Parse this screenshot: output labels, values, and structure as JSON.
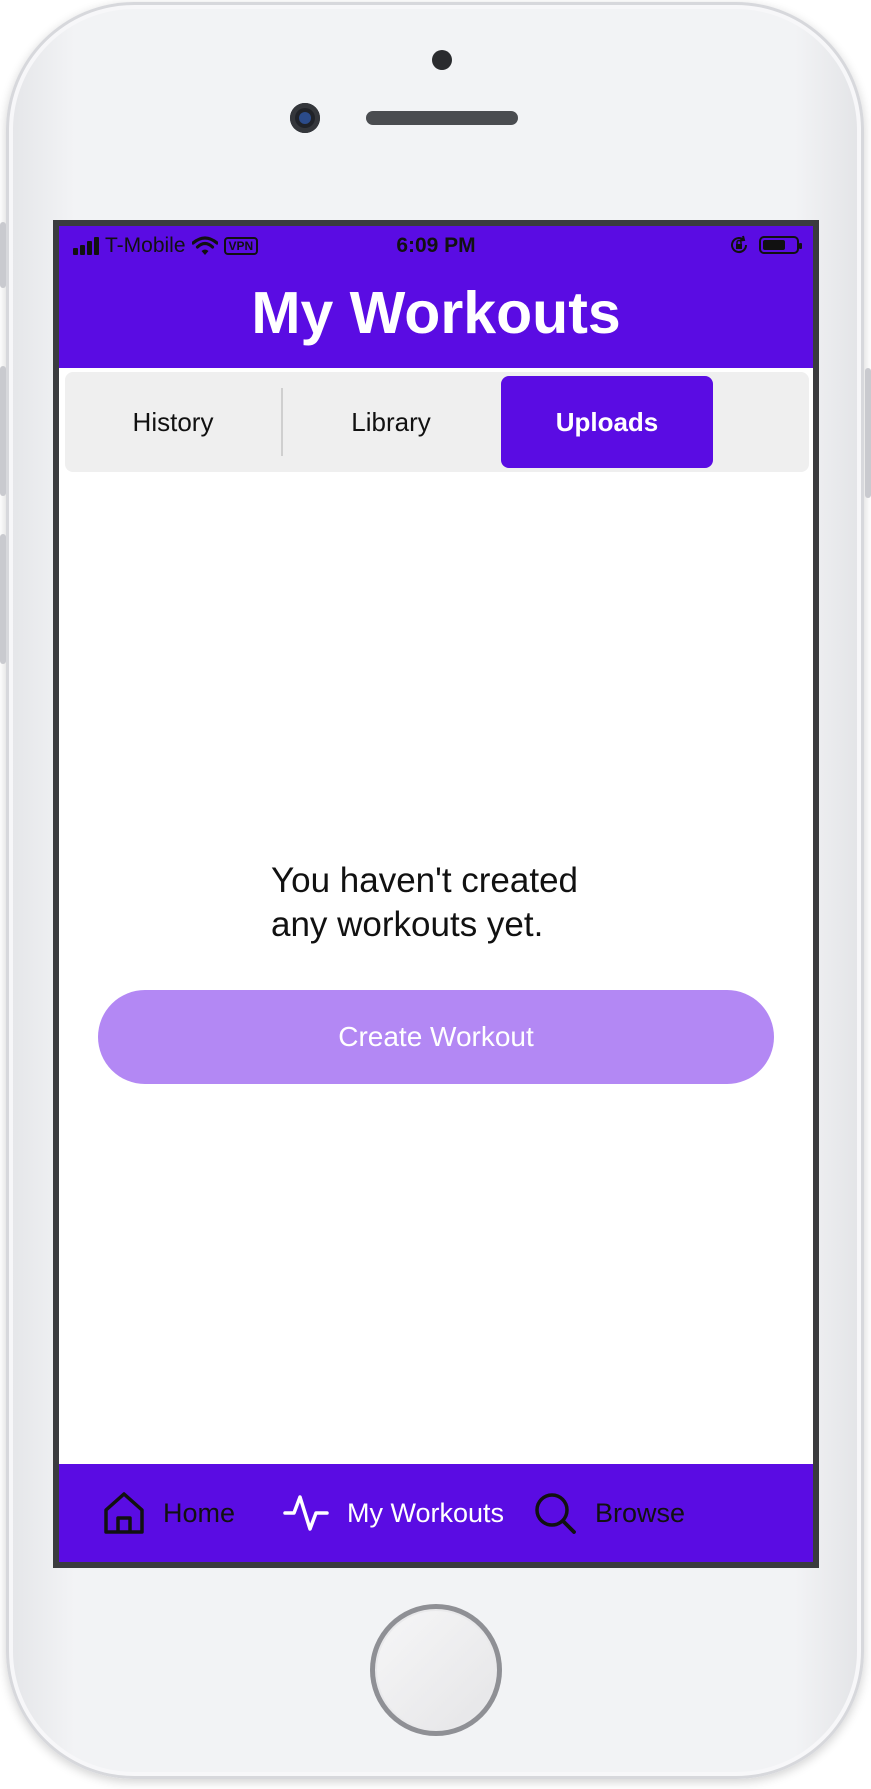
{
  "status_bar": {
    "carrier": "T-Mobile",
    "vpn_label": "VPN",
    "time": "6:09 PM"
  },
  "header": {
    "title": "My Workouts"
  },
  "tabs": [
    {
      "label": "History",
      "active": false
    },
    {
      "label": "Library",
      "active": false
    },
    {
      "label": "Uploads",
      "active": true
    }
  ],
  "empty_state": {
    "line1": "You haven't created",
    "line2": "any workouts yet."
  },
  "create_button": {
    "label": "Create Workout"
  },
  "bottom_nav": [
    {
      "label": "Home",
      "icon": "home-icon",
      "active": false
    },
    {
      "label": "My Workouts",
      "icon": "activity-icon",
      "active": true
    },
    {
      "label": "Browse",
      "icon": "search-icon",
      "active": false
    }
  ],
  "colors": {
    "primary": "#5a0ce3",
    "button_disabled": "#b388f4",
    "tab_bg": "#efefef",
    "inactive_nav": "#111111",
    "active_nav": "#ffffff"
  }
}
